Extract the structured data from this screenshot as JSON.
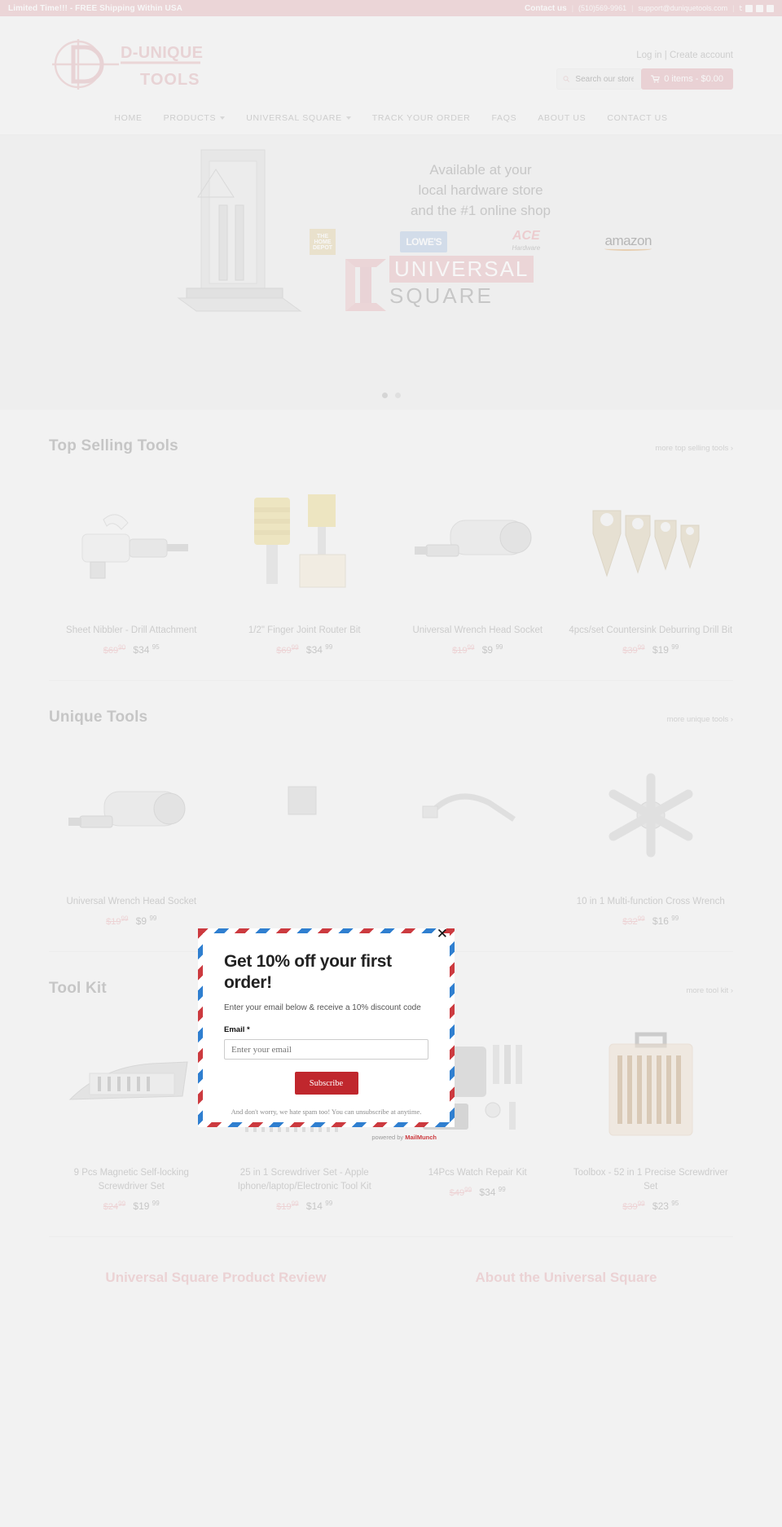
{
  "announcement": {
    "promo": "Limited Time!!! - FREE Shipping Within USA",
    "contact_label": "Contact us",
    "phone": "(510)569-9961",
    "email": "support@duniquetools.com",
    "social": [
      "twitter-icon",
      "facebook-icon",
      "youtube-icon",
      "instagram-icon"
    ]
  },
  "header": {
    "logo_primary": "D-UNIQUE",
    "logo_secondary": "TOOLS",
    "login": "Log in",
    "divider": "|",
    "create_account": "Create account",
    "search_placeholder": "Search our store",
    "search_value": "",
    "cart_label": "0 items - $0.00"
  },
  "nav": {
    "items": [
      {
        "label": "HOME",
        "has_dropdown": false
      },
      {
        "label": "PRODUCTS",
        "has_dropdown": true
      },
      {
        "label": "UNIVERSAL SQUARE",
        "has_dropdown": true
      },
      {
        "label": "TRACK YOUR ORDER",
        "has_dropdown": false
      },
      {
        "label": "FAQS",
        "has_dropdown": false
      },
      {
        "label": "ABOUT US",
        "has_dropdown": false
      },
      {
        "label": "CONTACT US",
        "has_dropdown": false
      }
    ]
  },
  "hero": {
    "line1": "Available at your",
    "line2": "local hardware store",
    "line3": "and the #1 online shop",
    "brands": [
      "THE HOME DEPOT",
      "LOWE'S",
      "ACE",
      "Hardware",
      "amazon"
    ],
    "product_word1": "UNIVERSAL",
    "product_word2": "SQUARE",
    "slide_count": 2,
    "active_slide": 1
  },
  "sections": [
    {
      "title": "Top Selling Tools",
      "more": "more top selling tools ›",
      "products": [
        {
          "name": "Sheet Nibbler - Drill Attachment",
          "old_price": "$69",
          "old_cents": "90",
          "new_price": "$34",
          "new_cents": "95",
          "image": "drill-attachment-image"
        },
        {
          "name": "1/2\" Finger Joint Router Bit",
          "old_price": "$69",
          "old_cents": "99",
          "new_price": "$34",
          "new_cents": "99",
          "image": "router-bit-image"
        },
        {
          "name": "Universal Wrench Head Socket",
          "old_price": "$19",
          "old_cents": "99",
          "new_price": "$9",
          "new_cents": "99",
          "image": "wrench-socket-image"
        },
        {
          "name": "4pcs/set Countersink Deburring Drill Bit",
          "old_price": "$39",
          "old_cents": "99",
          "new_price": "$19",
          "new_cents": "99",
          "image": "countersink-bit-image"
        }
      ]
    },
    {
      "title": "Unique Tools",
      "more": "more unique tools ›",
      "products": [
        {
          "name": "Universal Wrench Head Socket",
          "old_price": "$19",
          "old_cents": "99",
          "new_price": "$9",
          "new_cents": "99",
          "image": "wrench-socket-image"
        },
        {
          "name": "",
          "old_price": "",
          "old_cents": "",
          "new_price": "",
          "new_cents": "",
          "image": "hidden-product-image"
        },
        {
          "name": "",
          "old_price": "",
          "old_cents": "",
          "new_price": "",
          "new_cents": "",
          "image": "hidden-product-image"
        },
        {
          "name": "10 in 1 Multi-function Cross Wrench",
          "old_price": "$32",
          "old_cents": "99",
          "new_price": "$16",
          "new_cents": "99",
          "image": "cross-wrench-image"
        }
      ]
    },
    {
      "title": "Tool Kit",
      "more": "more tool kit ›",
      "products": [
        {
          "name": "9 Pcs Magnetic Self-locking Screwdriver Set",
          "old_price": "$24",
          "old_cents": "99",
          "new_price": "$19",
          "new_cents": "99",
          "image": "magnetic-screwdriver-set-image"
        },
        {
          "name": "25 in 1 Screwdriver Set - Apple Iphone/laptop/Electronic Tool Kit",
          "old_price": "$19",
          "old_cents": "99",
          "new_price": "$14",
          "new_cents": "99",
          "image": "screwdriver-set-25-image"
        },
        {
          "name": "14Pcs Watch Repair Kit",
          "old_price": "$49",
          "old_cents": "99",
          "new_price": "$34",
          "new_cents": "99",
          "image": "watch-repair-kit-image"
        },
        {
          "name": "Toolbox - 52 in 1 Precise Screwdriver Set",
          "old_price": "$39",
          "old_cents": "99",
          "new_price": "$23",
          "new_cents": "95",
          "image": "toolbox-52-image"
        }
      ]
    }
  ],
  "footer_headings": [
    "Universal Square Product Review",
    "About the Universal Square"
  ],
  "modal": {
    "heading": "Get 10% off your first order!",
    "subtext": "Enter your email below & receive a 10% discount code",
    "field_label": "Email *",
    "email_placeholder": "Enter your email",
    "email_value": "",
    "submit_label": "Subscribe",
    "disclaimer": "And don't worry, we hate spam too! You can unsubscribe at anytime.",
    "powered_prefix": "powered by ",
    "powered_brand": "MailMunch",
    "close_label": "✕"
  },
  "colors": {
    "accent_pink": "#e2aeb2",
    "page_bg": "#f2f2f2",
    "modal_red": "#c0272d",
    "modal_blue": "#2f7fd0",
    "old_price": "#e8a9ae"
  }
}
